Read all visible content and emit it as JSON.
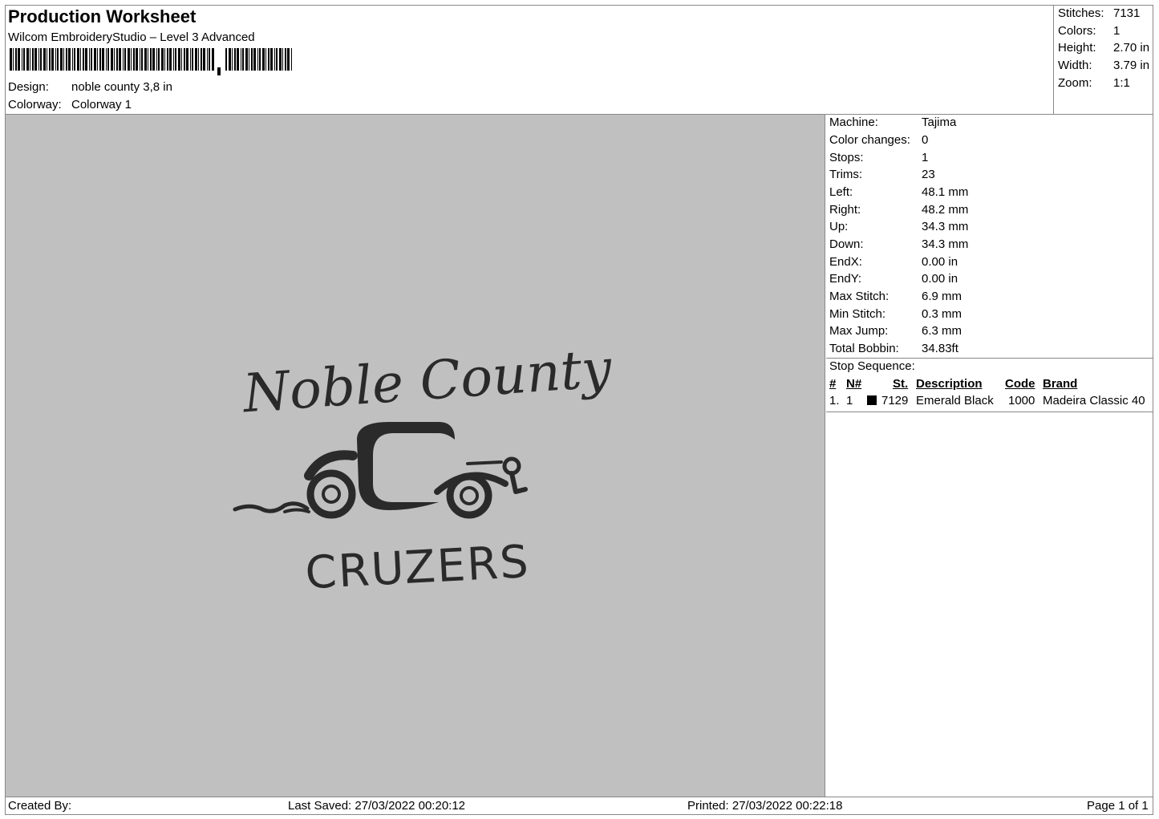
{
  "header": {
    "title": "Production Worksheet",
    "software": "Wilcom EmbroideryStudio – Level 3 Advanced",
    "design_label": "Design:",
    "design_value": "noble county 3,8 in",
    "colorway_label": "Colorway:",
    "colorway_value": "Colorway 1"
  },
  "summary": [
    {
      "label": "Stitches:",
      "value": "7131"
    },
    {
      "label": "Colors:",
      "value": "1"
    },
    {
      "label": "Height:",
      "value": "2.70 in"
    },
    {
      "label": "Width:",
      "value": "3.79 in"
    },
    {
      "label": "Zoom:",
      "value": "1:1"
    }
  ],
  "design_preview": {
    "line1": "Noble County",
    "line2": "CRUZERS",
    "thread_color": "#2a2a2a",
    "background": "#c0c0c0"
  },
  "machine_info": [
    {
      "label": "Machine:",
      "value": "Tajima"
    },
    {
      "label": "Color changes:",
      "value": "0"
    },
    {
      "label": "Stops:",
      "value": "1"
    },
    {
      "label": "Trims:",
      "value": "23"
    },
    {
      "label": "Left:",
      "value": "48.1 mm"
    },
    {
      "label": "Right:",
      "value": "48.2 mm"
    },
    {
      "label": "Up:",
      "value": "34.3 mm"
    },
    {
      "label": "Down:",
      "value": "34.3 mm"
    },
    {
      "label": "EndX:",
      "value": "0.00 in"
    },
    {
      "label": "EndY:",
      "value": "0.00 in"
    },
    {
      "label": "Max Stitch:",
      "value": "6.9 mm"
    },
    {
      "label": "Min Stitch:",
      "value": "0.3 mm"
    },
    {
      "label": "Max Jump:",
      "value": "6.3 mm"
    },
    {
      "label": "Total Bobbin:",
      "value": "34.83ft"
    }
  ],
  "stop_sequence": {
    "title": "Stop Sequence:",
    "headers": {
      "num": "#",
      "n": "N#",
      "st": "St.",
      "description": "Description",
      "code": "Code",
      "brand": "Brand"
    },
    "rows": [
      {
        "num": "1.",
        "n": "1",
        "swatch": "#000000",
        "st": "7129",
        "description": "Emerald Black",
        "code": "1000",
        "brand": "Madeira Classic 40"
      }
    ]
  },
  "footer": {
    "created_by": "Created By:",
    "last_saved": "Last Saved: 27/03/2022 00:20:12",
    "printed": "Printed: 27/03/2022 00:22:18",
    "page": "Page 1 of 1"
  }
}
